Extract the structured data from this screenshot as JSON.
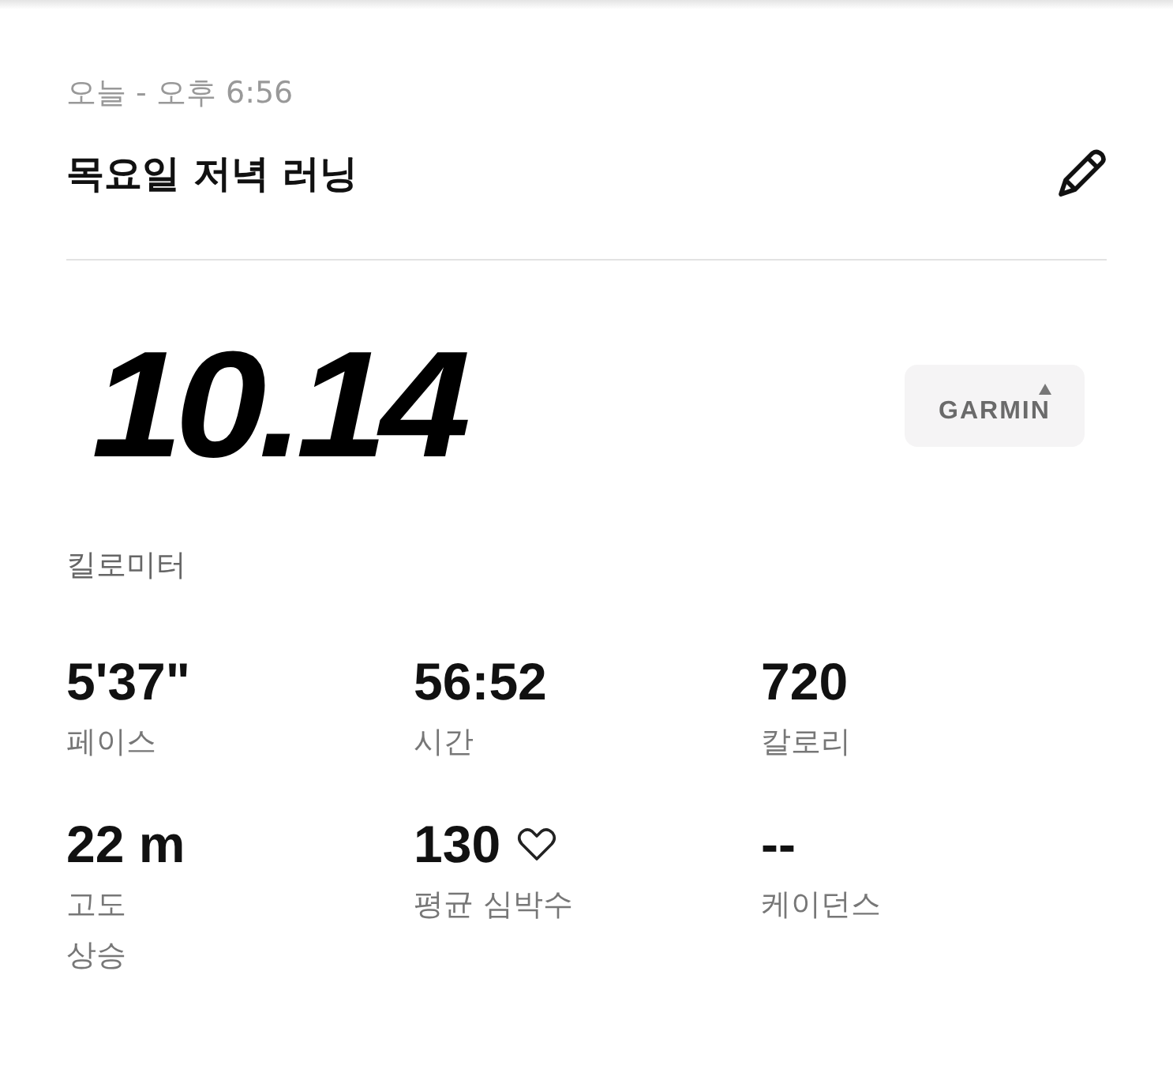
{
  "activity": {
    "date": "오늘 - 오후 6:56",
    "title": "목요일 저녁 러닝"
  },
  "distance": {
    "value": "10.14",
    "unit": "킬로미터"
  },
  "source": {
    "label": "GARMIN"
  },
  "stats": [
    {
      "kind": "plain",
      "value": "5'37\"",
      "label": "페이스"
    },
    {
      "kind": "plain",
      "value": "56:52",
      "label": "시간"
    },
    {
      "kind": "plain",
      "value": "720",
      "label": "칼로리"
    },
    {
      "kind": "plain",
      "value": "22 m",
      "label": "고도\n상승"
    },
    {
      "kind": "heart",
      "value": "130",
      "label": "평균 심박수"
    },
    {
      "kind": "plain",
      "value": "--",
      "label": "케이던스"
    }
  ]
}
